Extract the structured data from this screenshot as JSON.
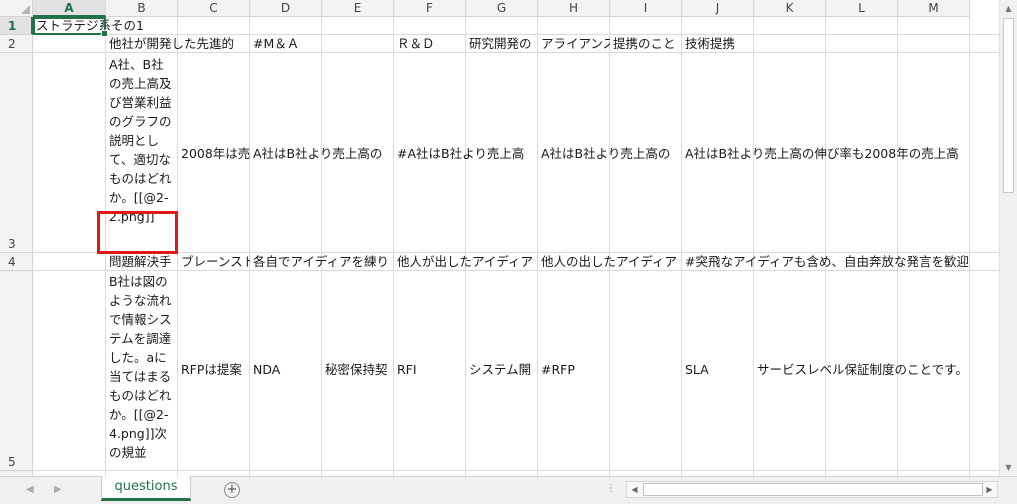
{
  "columns": [
    "A",
    "B",
    "C",
    "D",
    "E",
    "F",
    "G",
    "H",
    "I",
    "J",
    "K",
    "L",
    "M"
  ],
  "rows": [
    "1",
    "2",
    "3",
    "4",
    "5"
  ],
  "cells": {
    "A1": "ストラテジ系その1",
    "B2": "他社が開発した先進的",
    "C2": "",
    "D2": "#M＆Ａ",
    "F2": "Ｒ＆Ｄ",
    "G2": "研究開発の",
    "H2": "アライアンス",
    "I2": "提携のこと",
    "J2": "技術提携",
    "B3": "A社、B社の売上高及び営業利益のグラフの説明として、適切なものはどれか。[[@2-2.png]]",
    "C3": "2008年は売",
    "D3": "A社はB社より売上高の",
    "F3": "#A社はB社より売上高",
    "H3": "A社はB社より売上高の",
    "J3": "A社はB社より売上高の伸び率も2008年の売上高",
    "B4": "問題解決手",
    "C4": "ブレーンスト",
    "D4": "各自でアイディアを練り",
    "F4": "他人が出したアイディア",
    "H4": "他人の出したアイディア",
    "J4": "#突飛なアイディアも含め、自由奔放な発言を歓迎",
    "B5": "B社は図のような流れで情報システムを調達した。aに当てはまるものはどれか。[[@2-4.png]]次の規並",
    "C5": "RFPは提案",
    "D5": "NDA",
    "E5": "秘密保持契",
    "F5": "RFI",
    "G5": "システム開",
    "H5": "#RFP",
    "J5": "SLA",
    "K5": "サービスレベル保証制度のことです。"
  },
  "selected_cell": "A1",
  "sheet_tab": "questions",
  "icons": {
    "nav_prev": "triangle-left-icon",
    "nav_next": "triangle-right-icon",
    "add_sheet": "plus-circle-icon"
  },
  "colors": {
    "accent": "#217346",
    "highlight": "#e01818"
  }
}
